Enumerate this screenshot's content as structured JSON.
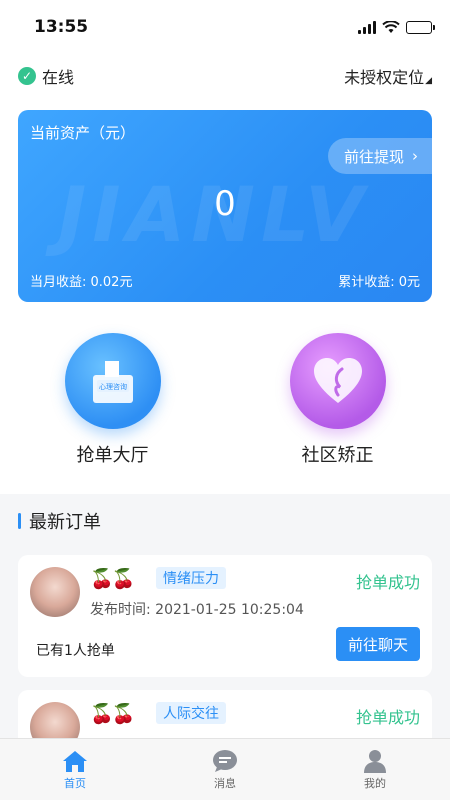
{
  "statusbar": {
    "time": "13:55"
  },
  "header": {
    "online_label": "在线",
    "location_label": "未授权定位"
  },
  "asset_card": {
    "title": "当前资产（元）",
    "watermark": "JIANLV",
    "withdraw_label": "前往提现",
    "value": "0",
    "month_income": "当月收益: 0.02元",
    "total_income": "累计收益:   0元"
  },
  "entries": [
    {
      "label": "抢单大厅",
      "icon_text": "心理咨询"
    },
    {
      "label": "社区矫正"
    }
  ],
  "section": {
    "title": "最新订单"
  },
  "orders": [
    {
      "cherries": "🍒🍒",
      "tag": "情绪压力",
      "status": "抢单成功",
      "time": "发布时间: 2021-01-25 10:25:04",
      "grab_count": "已有1人抢单",
      "button": "前往聊天"
    },
    {
      "cherries": "🍒🍒",
      "tag": "人际交往",
      "status": "抢单成功"
    }
  ],
  "tabbar": [
    {
      "label": "首页",
      "icon": "home-icon"
    },
    {
      "label": "消息",
      "icon": "message-icon"
    },
    {
      "label": "我的",
      "icon": "profile-icon"
    }
  ],
  "colors": {
    "primary": "#2b8ff5",
    "success": "#34c38f",
    "purple": "#b45be8"
  }
}
